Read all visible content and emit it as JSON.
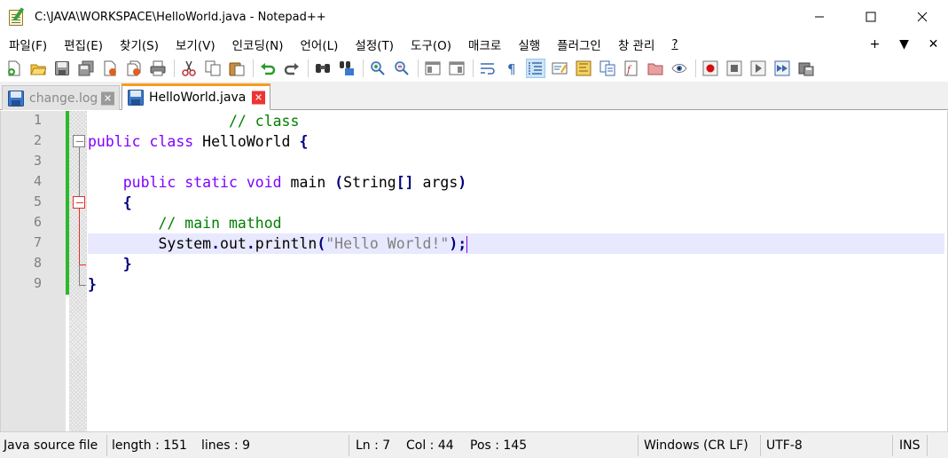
{
  "window": {
    "title": "C:\\JAVA\\WORKSPACE\\HelloWorld.java - Notepad++",
    "minimize": "—",
    "maximize": "☐",
    "close": "✕"
  },
  "menu": {
    "items": [
      "파일(F)",
      "편집(E)",
      "찾기(S)",
      "보기(V)",
      "인코딩(N)",
      "언어(L)",
      "설정(T)",
      "도구(O)",
      "매크로",
      "실행",
      "플러그인",
      "창 관리",
      "?"
    ],
    "right": [
      "+",
      "▼",
      "✕"
    ]
  },
  "toolbar": {
    "icons": [
      "new-file-icon",
      "open-file-icon",
      "save-icon",
      "save-all-icon",
      "close-icon",
      "close-all-icon",
      "print-icon",
      "cut-icon",
      "copy-icon",
      "paste-icon",
      "undo-icon",
      "redo-icon",
      "find-icon",
      "replace-icon",
      "zoom-in-icon",
      "zoom-out-icon",
      "sync-vertical-icon",
      "sync-horizontal-icon",
      "word-wrap-icon",
      "show-all-chars-icon",
      "indent-guide-icon",
      "user-defined-language-icon",
      "document-map-icon",
      "document-list-icon",
      "function-list-icon",
      "folder-as-workspace-icon",
      "monitoring-icon",
      "macro-record-icon",
      "macro-stop-icon",
      "macro-play-icon",
      "macro-run-multiple-icon",
      "macro-save-icon"
    ]
  },
  "tabs": [
    {
      "label": "change.log",
      "active": false,
      "close": "✕"
    },
    {
      "label": "HelloWorld.java",
      "active": true,
      "close": "✕"
    }
  ],
  "editor": {
    "line_numbers": [
      "1",
      "2",
      "3",
      "4",
      "5",
      "6",
      "7",
      "8",
      "9"
    ],
    "current_line": 7
  },
  "status": {
    "file_type": "Java source file",
    "length": "length : 151",
    "lines": "lines : 9",
    "ln": "Ln : 7",
    "col": "Col : 44",
    "pos": "Pos : 145",
    "eol": "Windows (CR LF)",
    "encoding": "UTF-8",
    "mode": "INS"
  },
  "colors": {
    "keyword": "#8000ff",
    "type_keyword": "#000080",
    "comment": "#008000",
    "string": "#808080",
    "active_tab_accent": "#fa9b1b",
    "change_bar": "#2db82d",
    "current_line": "#e8e8ff"
  }
}
